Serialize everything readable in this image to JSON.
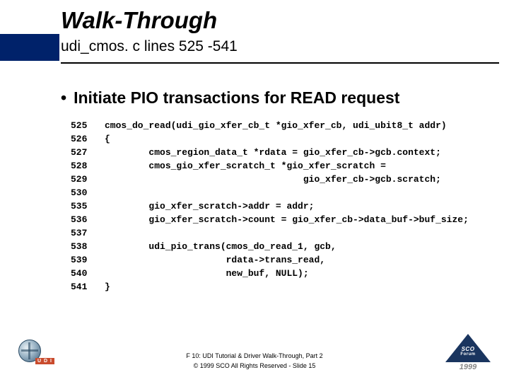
{
  "title": "Walk-Through",
  "subtitle": "udi_cmos. c lines 525 -541",
  "bullet": "Initiate PIO transactions for READ request",
  "code": [
    {
      "n": "525",
      "t": "cmos_do_read(udi_gio_xfer_cb_t *gio_xfer_cb, udi_ubit8_t addr)"
    },
    {
      "n": "526",
      "t": "{"
    },
    {
      "n": "527",
      "t": "        cmos_region_data_t *rdata = gio_xfer_cb->gcb.context;"
    },
    {
      "n": "528",
      "t": "        cmos_gio_xfer_scratch_t *gio_xfer_scratch ="
    },
    {
      "n": "529",
      "t": "                                    gio_xfer_cb->gcb.scratch;"
    },
    {
      "n": "530",
      "t": ""
    },
    {
      "n": "535",
      "t": "        gio_xfer_scratch->addr = addr;"
    },
    {
      "n": "536",
      "t": "        gio_xfer_scratch->count = gio_xfer_cb->data_buf->buf_size;"
    },
    {
      "n": "537",
      "t": ""
    },
    {
      "n": "538",
      "t": "        udi_pio_trans(cmos_do_read_1, gcb,"
    },
    {
      "n": "539",
      "t": "                      rdata->trans_read,"
    },
    {
      "n": "540",
      "t": "                      new_buf, NULL);"
    },
    {
      "n": "541",
      "t": "}"
    }
  ],
  "footer": {
    "line1": "F 10: UDI Tutorial & Driver Walk-Through, Part 2",
    "line2": "© 1999 SCO  All Rights Reserved - Slide 15"
  },
  "logos": {
    "left_tag": "U D I",
    "right_top": "SCO",
    "right_mid": "Forum",
    "right_year": "1999"
  }
}
